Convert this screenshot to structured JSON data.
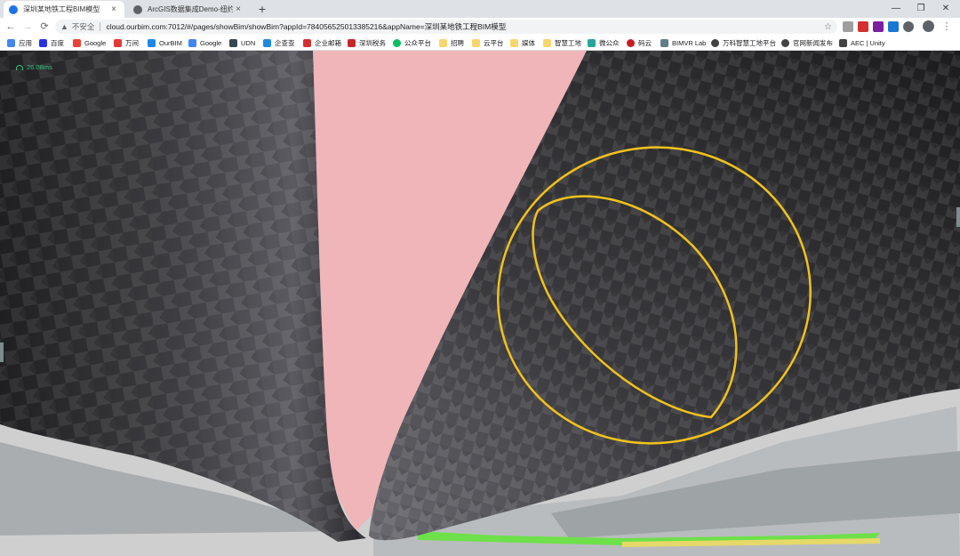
{
  "browser": {
    "tabs": [
      {
        "title": "深圳某地铁工程BIM模型",
        "active": true,
        "favicon_color": "#1a73e8"
      },
      {
        "title": "ArcGIS数据集成Demo-纽约市",
        "active": false,
        "favicon_color": "#5f6368"
      }
    ],
    "new_tab_symbol": "+",
    "close_symbol": "×",
    "window_controls": [
      "—",
      "❐",
      "✕"
    ],
    "nav": {
      "back": "←",
      "forward": "→",
      "reload": "⟳"
    },
    "address": {
      "warning_icon": "▲",
      "security_text": "不安全",
      "url": "cloud.ourbim.com:7012/#/pages/showBim/showBim?appId=784056525013385216&appName=深圳某地铁工程BIM模型",
      "star_icon": "☆"
    },
    "menu_symbol": "⋮"
  },
  "bookmarks": [
    {
      "label": "应用",
      "color": "#4285f4"
    },
    {
      "label": "百度",
      "color": "#2932e1"
    },
    {
      "label": "Google",
      "color": "#ea4335"
    },
    {
      "label": "万间",
      "color": "#e53935"
    },
    {
      "label": "OurBIM",
      "color": "#1e88e5"
    },
    {
      "label": "Google",
      "color": "#4285f4"
    },
    {
      "label": "UDN",
      "color": "#37474f"
    },
    {
      "label": "企查查",
      "color": "#1e88e5"
    },
    {
      "label": "企业邮箱",
      "color": "#d32f2f"
    },
    {
      "label": "深圳税务",
      "color": "#c62828"
    },
    {
      "label": "公众平台",
      "color": "#07c160"
    },
    {
      "label": "招聘",
      "color": "#f9d56e"
    },
    {
      "label": "云平台",
      "color": "#f9d56e"
    },
    {
      "label": "媒体",
      "color": "#f9d56e"
    },
    {
      "label": "智慧工地",
      "color": "#f9d56e"
    },
    {
      "label": "微公众",
      "color": "#26a69a"
    },
    {
      "label": "码云",
      "color": "#c71d23"
    },
    {
      "label": "BIMVR Lab",
      "color": "#607d8b"
    },
    {
      "label": "万科智慧工地平台",
      "color": "#424242"
    },
    {
      "label": "官网新闻发布",
      "color": "#424242"
    },
    {
      "label": "AEC | Unity",
      "color": "#424242"
    }
  ],
  "viewport": {
    "fps_text": "26.08ms",
    "colors": {
      "sky": "#efb5b8",
      "tube_dark": "#2b2b2d",
      "tube_mid": "#4a4a4e",
      "tube_light": "#8a8a90",
      "highlight_ring": "#f2c21b",
      "ground": "#cfcfcf",
      "green_band": "#6ee04a"
    }
  }
}
